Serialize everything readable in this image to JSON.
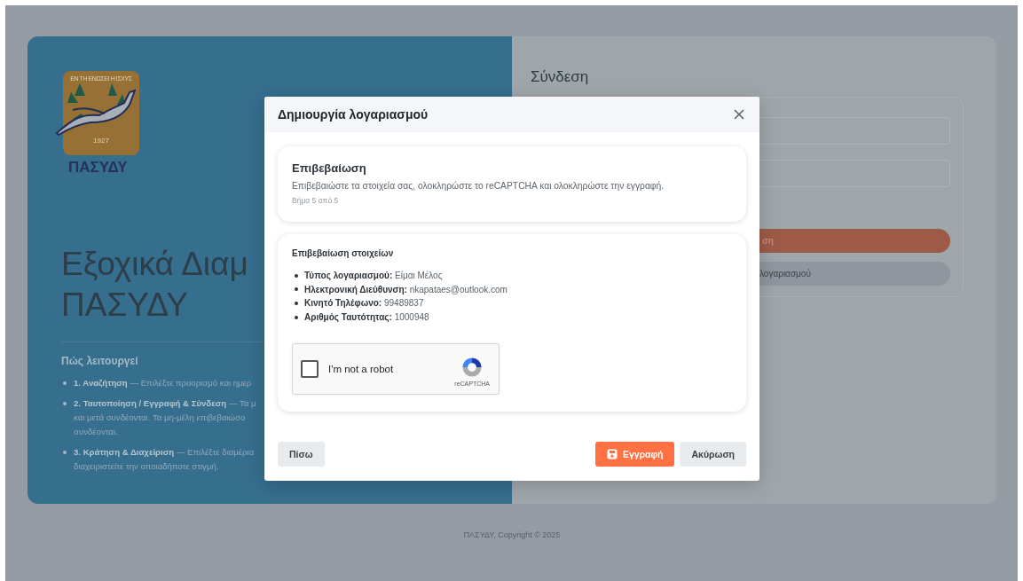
{
  "background": {
    "logo": {
      "motto": "ΕΝ ΤΗ ΕΝΩΣΕΙ Η ΙΣΧΥΣ",
      "year": "1927",
      "name": "ΠΑΣΥΔΥ"
    },
    "headline": [
      "Εξοχικά Διαμ",
      "ΠΑΣΥΔΥ"
    ],
    "how_title": "Πώς λειτουργεί",
    "how_steps": [
      {
        "lines": [
          "**1. Αναζήτηση** — Επιλέξτε προορισμό και ημερ"
        ]
      },
      {
        "lines": [
          "**2. Ταυτοποίηση / Εγγραφή & Σύνδεση** — Τα μ",
          "και μετά συνδέονται. Τα μη-μέλη επιβεβαιώσο",
          "συνδέονται."
        ]
      },
      {
        "lines": [
          "**3. Κράτηση & Διαχείριση** — Επιλέξτε διαμέρια",
          "διαχειριστείτε την οποιαδήποτε στιγμή."
        ]
      }
    ],
    "login": {
      "title": "Σύνδεση",
      "primary_button": "ση",
      "secondary_button": "λογαριασμού"
    },
    "footer": "ΠΑΣΥΔΥ, Copyright © 2025"
  },
  "dialog": {
    "title": "Δημιουργία λογαριασμού",
    "step": {
      "title": "Επιβεβαίωση",
      "description": "Επιβεβαιώστε τα στοιχεία σας, ολοκληρώστε το reCAPTCHA και ολοκληρώστε την εγγραφή.",
      "progress": "Βήμα 5 από 5"
    },
    "summary": {
      "title": "Επιβεβαίωση στοιχείων",
      "items": [
        "**Τύπος λογαριασμού:** Είμαι Μέλος",
        "**Ηλεκτρονική Διεύθυνση:** nkapataes@outlook.com",
        "**Κινητό Τηλέφωνο:** 99489837",
        "**Αριθμός Ταυτότητας:** 1000948"
      ]
    },
    "captcha": {
      "label": "I'm not a robot",
      "brand": "reCAPTCHA",
      "checked": false
    },
    "buttons": [
      {
        "label": "Πίσω",
        "kind": "back"
      },
      {
        "label": "Εγγραφή",
        "kind": "primary"
      },
      {
        "label": "Ακύρωση",
        "kind": "cancel"
      }
    ]
  }
}
